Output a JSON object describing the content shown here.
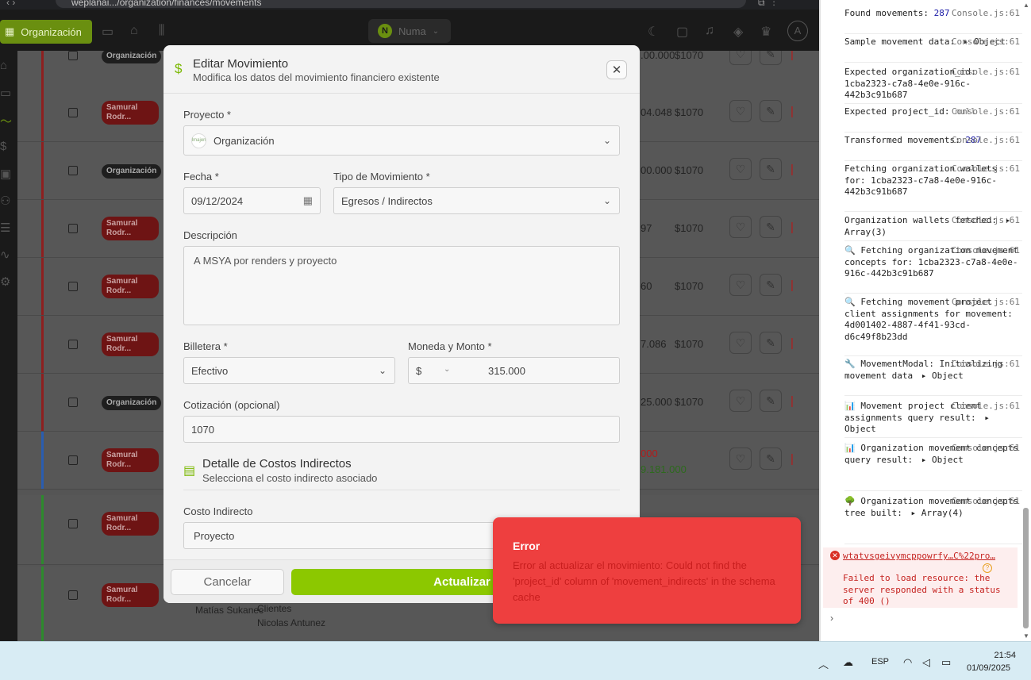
{
  "browser": {
    "address": "weplanai.../organization/finances/movements",
    "header": {
      "org_label": "Organización",
      "user_initial": "N",
      "user_name": "Numa"
    }
  },
  "table": {
    "rows": [
      {
        "tag": "Organización",
        "tag_type": "org",
        "amount": ".00.000",
        "usd": "$1070"
      },
      {
        "tag": "Samural Rodr...",
        "tag_type": "person",
        "amount": "04.048",
        "usd": "$1070"
      },
      {
        "tag": "Organización",
        "tag_type": "org",
        "amount": "00.000",
        "usd": "$1070"
      },
      {
        "tag": "Samural Rodr...",
        "tag_type": "person",
        "amount": "97",
        "usd": "$1070"
      },
      {
        "tag": "Samural Rodr...",
        "tag_type": "person",
        "amount": "60",
        "usd": "$1070"
      },
      {
        "tag": "Samural Rodr...",
        "tag_type": "person",
        "amount": "7.086",
        "usd": "$1070"
      },
      {
        "tag": "Organización",
        "tag_type": "org",
        "amount": "25.000",
        "usd": "$1070"
      },
      {
        "tag": "Samural Rodr...",
        "tag_type": "person",
        "amount": "000",
        "usd": "9.181.000"
      },
      {
        "tag": "Samural Rodr...",
        "tag_type": "person",
        "amount": "",
        "usd": ""
      },
      {
        "tag": "Samural Rodr...",
        "tag_type": "person",
        "amount": "",
        "usd": ""
      }
    ],
    "bottom_text": {
      "name1": "Matías Sukanec",
      "clients": "Clientes",
      "name2": "Nicolas Antunez"
    }
  },
  "modal": {
    "title": "Editar Movimiento",
    "subtitle": "Modifica los datos del movimiento financiero existente",
    "project_label": "Proyecto *",
    "project_value": "Organización",
    "project_logo_text": "Imajen",
    "date_label": "Fecha *",
    "date_value": "09/12/2024",
    "type_label": "Tipo de Movimiento *",
    "type_value": "Egresos / Indirectos",
    "description_label": "Descripción",
    "description_value": "A MSYA por renders y proyecto",
    "wallet_label": "Billetera *",
    "wallet_value": "Efectivo",
    "currency_label": "Moneda y Monto *",
    "currency_value": "$",
    "amount_value": "315.000",
    "rate_label": "Cotización (opcional)",
    "rate_value": "1070",
    "section_title": "Detalle de Costos Indirectos",
    "section_subtitle": "Selecciona el costo indirecto asociado",
    "indirect_label": "Costo Indirecto",
    "indirect_value": "Proyecto",
    "cancel_label": "Cancelar",
    "update_label": "Actualizar"
  },
  "toast": {
    "title": "Error",
    "message": "Error al actualizar el movimiento: Could not find the 'project_id' column of 'movement_indirects' in the schema cache"
  },
  "console": {
    "source": "Console.js:61",
    "logs": [
      {
        "text": "Found movements:",
        "value": "287"
      },
      {
        "text": "Sample movement data:",
        "obj": "Object"
      },
      {
        "text": "Expected organization_id: 1cba2323-c7a8-4e0e-916c-442b3c91b687"
      },
      {
        "text": "Expected project_id:",
        "nul": "null"
      },
      {
        "text": "Transformed movements:",
        "value": "287"
      },
      {
        "text": "Fetching organization wallets for: 1cba2323-c7a8-4e0e-916c-442b3c91b687"
      },
      {
        "text": "Organization wallets fetched:",
        "obj": "Array(3)"
      },
      {
        "text": "🔍 Fetching organization movement concepts for: 1cba2323-c7a8-4e0e-916c-442b3c91b687"
      },
      {
        "text": "🔍 Fetching movement project client assignments for movement: 4d001402-4887-4f41-93cd-d6c49f8b23dd"
      },
      {
        "text": "🔧 MovementModal: Initializing movement data",
        "obj": "Object"
      },
      {
        "text": "📊 Movement project client assignments query result:",
        "obj": "Object"
      },
      {
        "text": "📊 Organization movement concepts query result:",
        "obj": "Object"
      },
      {
        "text": "🌳 Organization movement concepts tree built:",
        "obj": "Array(4)"
      }
    ],
    "error_link": "wtatvsgeivymcppowrfy…C%22pro…",
    "error_text": "Failed to load resource: the server responded with a status of 400 ()",
    "prompt": "›"
  },
  "taskbar": {
    "lang": "ESP",
    "time": "21:54",
    "date": "01/09/2025"
  }
}
